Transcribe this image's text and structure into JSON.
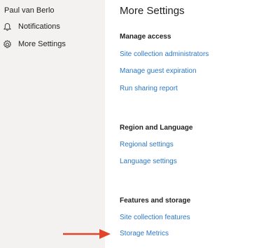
{
  "sidebar": {
    "user_name": "Paul van Berlo",
    "items": [
      {
        "label": "Notifications",
        "icon": "bell-icon"
      },
      {
        "label": "More Settings",
        "icon": "gear-icon"
      }
    ]
  },
  "main": {
    "title": "More Settings",
    "sections": [
      {
        "heading": "Manage access",
        "links": [
          "Site collection administrators",
          "Manage guest expiration",
          "Run sharing report"
        ]
      },
      {
        "heading": "Region and Language",
        "links": [
          "Regional settings",
          "Language settings"
        ]
      },
      {
        "heading": "Features and storage",
        "links": [
          "Site collection features",
          "Storage Metrics"
        ]
      }
    ]
  },
  "colors": {
    "link": "#2b77c4",
    "sidebar_bg": "#f3f2f1",
    "arrow": "#e0452b"
  }
}
